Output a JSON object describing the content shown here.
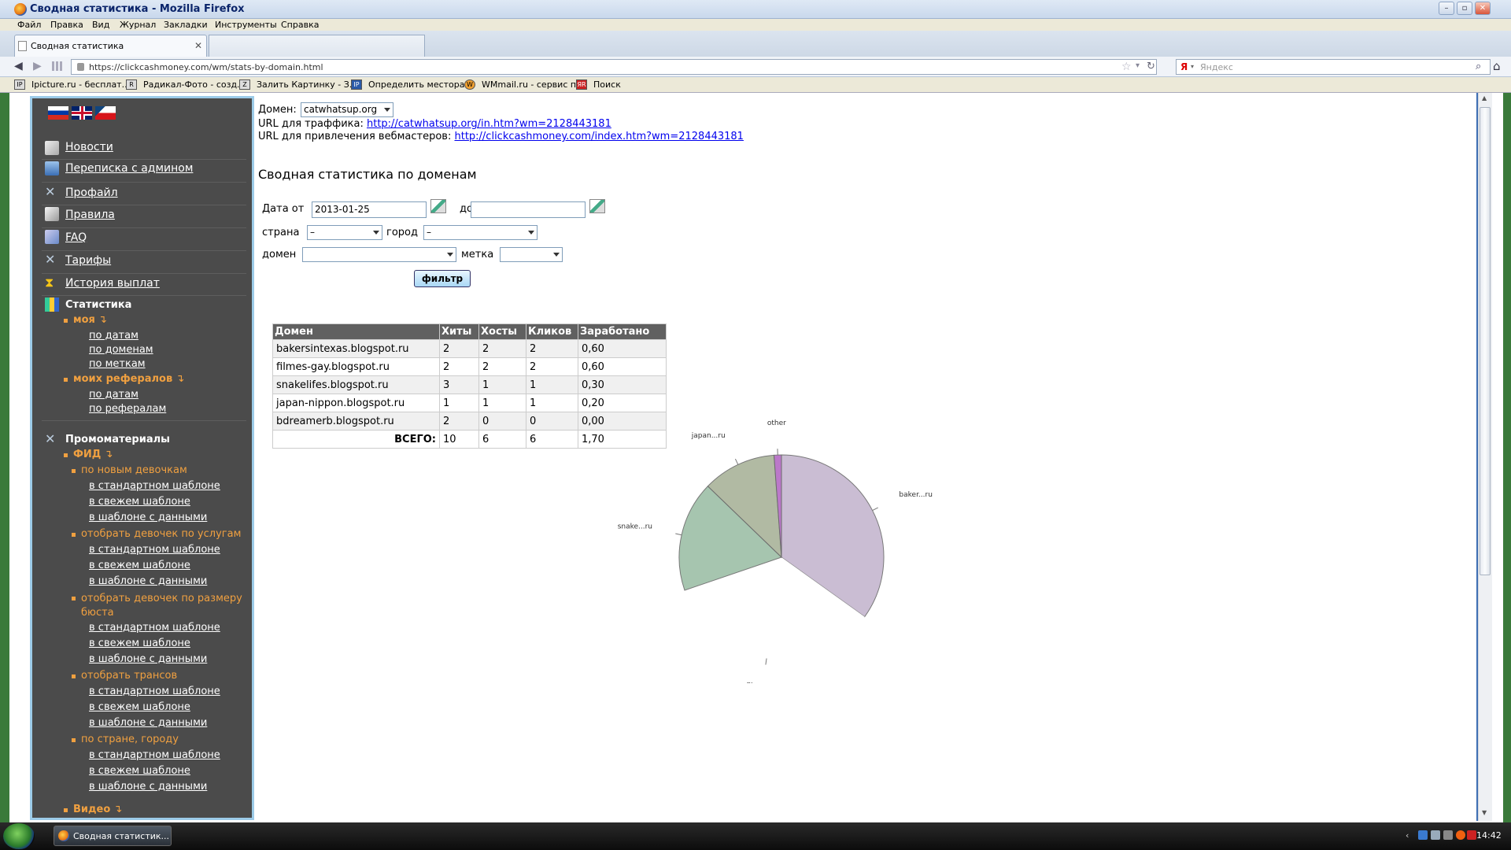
{
  "window": {
    "title": "Сводная статистика - Mozilla Firefox",
    "menu": [
      "Файл",
      "Правка",
      "Вид",
      "Журнал",
      "Закладки",
      "Инструменты",
      "Справка"
    ]
  },
  "tab": {
    "label": "Сводная статистика"
  },
  "nav": {
    "url": "https://clickcashmoney.com/wm/stats-by-domain.html",
    "search_placeholder": "Яндекс"
  },
  "bookmarks": [
    {
      "label": "Ipicture.ru - бесплат...",
      "icon": "IP"
    },
    {
      "label": "Радикал-Фото - созд...",
      "icon": "R"
    },
    {
      "label": "Залить Картинку - З...",
      "icon": "Z"
    },
    {
      "label": "Определить местора...",
      "icon": "IP"
    },
    {
      "label": "WMmail.ru - сервис п...",
      "icon": "W"
    },
    {
      "label": "Поиск",
      "icon": "ЯR"
    }
  ],
  "sidebar": {
    "menu": [
      {
        "label": "Новости",
        "icon": "news-icon"
      },
      {
        "label": "Переписка с админом",
        "icon": "mail-icon"
      },
      {
        "label": "Профайл",
        "icon": "tools-icon"
      },
      {
        "label": "Правила",
        "icon": "rules-icon"
      },
      {
        "label": "FAQ",
        "icon": "faq-icon"
      },
      {
        "label": "Тарифы",
        "icon": "tools-icon"
      },
      {
        "label": "История выплат",
        "icon": "hourglass-icon"
      }
    ],
    "stats": {
      "title": "Статистика",
      "mine": "моя",
      "mine_items": [
        "по датам",
        "по доменам",
        "по меткам"
      ],
      "refs": "моих рефералов",
      "refs_items": [
        "по датам",
        "по рефералам"
      ]
    },
    "promo": {
      "title": "Промоматериалы",
      "fid": "ФИД",
      "groups": [
        {
          "label": "по новым девочкам",
          "items": [
            "в стандартном шаблоне",
            "в свежем шаблоне",
            "в шаблоне с данными"
          ]
        },
        {
          "label": "отобрать девочек по услугам",
          "items": [
            "в стандартном шаблоне",
            "в свежем шаблоне",
            "в шаблоне с данными"
          ]
        },
        {
          "label": "отобрать девочек по размеру бюста",
          "items": [
            "в стандартном шаблоне",
            "в свежем шаблоне",
            "в шаблоне с данными"
          ]
        },
        {
          "label": "отобрать трансов",
          "items": [
            "в стандартном шаблоне",
            "в свежем шаблоне",
            "в шаблоне с данными"
          ]
        },
        {
          "label": "по стране, городу",
          "items": [
            "в стандартном шаблоне",
            "в свежем шаблоне",
            "в шаблоне с данными"
          ]
        }
      ],
      "video": "Видео"
    }
  },
  "main": {
    "domain_label": "Домен:",
    "domain_value": "catwhatsup.org",
    "traffic_label": "URL для траффика:",
    "traffic_url": "http://catwhatsup.org/in.htm?wm=2128443181",
    "webmaster_label": "URL для привлечения вебмастеров:",
    "webmaster_url": "http://clickcashmoney.com/index.htm?wm=2128443181",
    "heading": "Сводная статистика по доменам",
    "filters": {
      "date_from_label": "Дата от",
      "date_from": "2013-01-25",
      "date_to_label": "до",
      "date_to": "",
      "country_label": "страна",
      "country": "–",
      "city_label": "город",
      "city": "–",
      "domain_label": "домен",
      "domain": "",
      "tag_label": "метка",
      "tag": "",
      "button": "фильтр"
    },
    "table": {
      "headers": [
        "Домен",
        "Хиты",
        "Хосты",
        "Кликов",
        "Заработано"
      ],
      "rows": [
        [
          "bakersintexas.blogspot.ru",
          "2",
          "2",
          "2",
          "0,60"
        ],
        [
          "filmes-gay.blogspot.ru",
          "2",
          "2",
          "2",
          "0,60"
        ],
        [
          "snakelifes.blogspot.ru",
          "3",
          "1",
          "1",
          "0,30"
        ],
        [
          "japan-nippon.blogspot.ru",
          "1",
          "1",
          "1",
          "0,20"
        ],
        [
          "bdreamerb.blogspot.ru",
          "2",
          "0",
          "0",
          "0,00"
        ]
      ],
      "total_label": "ВСЕГО:",
      "totals": [
        "10",
        "6",
        "6",
        "1,70"
      ]
    }
  },
  "chart_data": {
    "type": "pie",
    "slices": [
      {
        "label": "baker...ru",
        "value": 0.6,
        "color": "#c5b6cf"
      },
      {
        "label": "filme...ru",
        "value": 0.6,
        "color": "#ffffff"
      },
      {
        "label": "snake...ru",
        "value": 0.3,
        "color": "#9dbfa7"
      },
      {
        "label": "japan...ru",
        "value": 0.2,
        "color": "#a9b39a"
      },
      {
        "label": "other",
        "value": 0.02,
        "color": "#b46ac4"
      }
    ]
  },
  "taskbar": {
    "task": "Сводная статистик...",
    "clock": "14:42"
  }
}
